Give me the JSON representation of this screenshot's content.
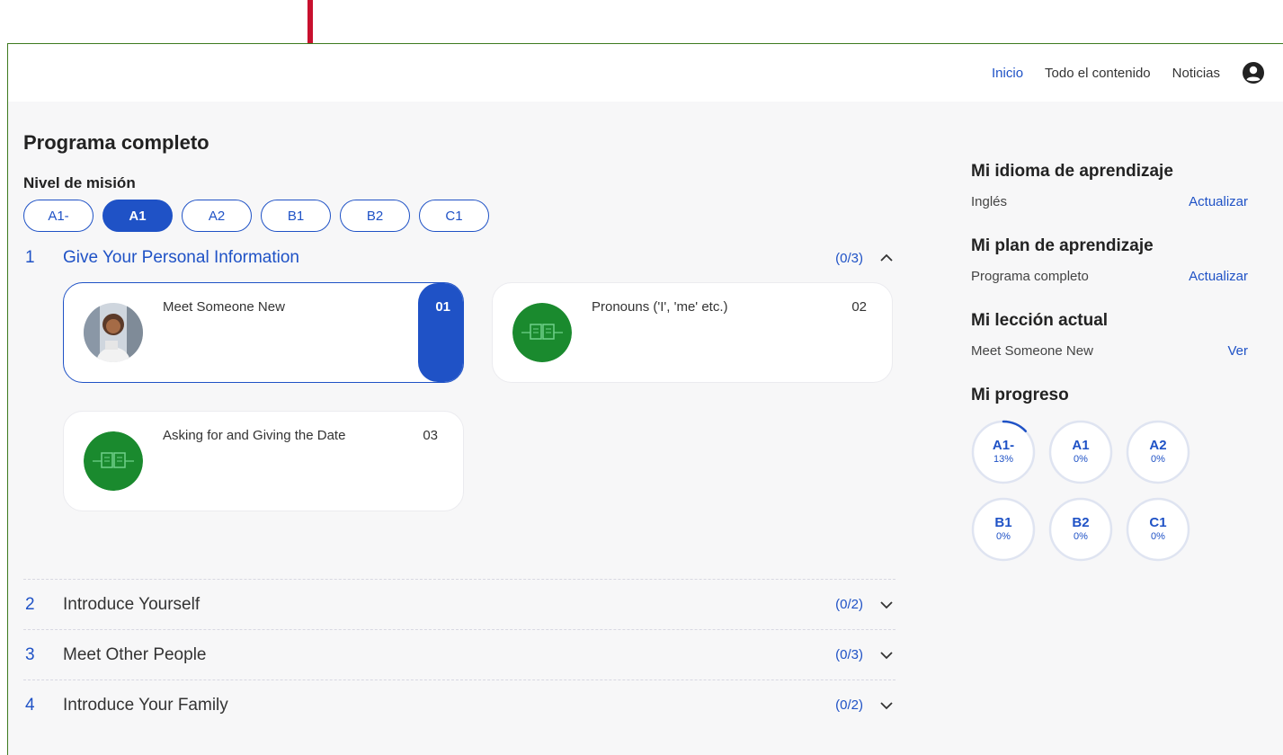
{
  "nav": {
    "links": [
      "Inicio",
      "Todo el contenido",
      "Noticias"
    ],
    "active": "Inicio",
    "profile_icon": "user-circle-icon"
  },
  "main": {
    "title": "Programa completo",
    "level_label": "Nivel de misión",
    "levels": [
      "A1-",
      "A1",
      "A2",
      "B1",
      "B2",
      "C1"
    ],
    "active_level": "A1",
    "units": [
      {
        "num": "1",
        "title": "Give Your Personal Information",
        "count": "(0/3)",
        "expanded": true,
        "lessons": [
          {
            "title": "Meet Someone New",
            "num": "01",
            "selected": true
          },
          {
            "title": "Pronouns ('I', 'me' etc.)",
            "num": "02"
          },
          {
            "title": "Asking for and Giving the Date",
            "num": "03"
          }
        ]
      },
      {
        "num": "2",
        "title": "Introduce Yourself",
        "count": "(0/2)"
      },
      {
        "num": "3",
        "title": "Meet Other People",
        "count": "(0/3)"
      },
      {
        "num": "4",
        "title": "Introduce Your Family",
        "count": "(0/2)"
      }
    ]
  },
  "side": {
    "language": {
      "heading": "Mi idioma de aprendizaje",
      "value": "Inglés",
      "action": "Actualizar"
    },
    "plan": {
      "heading": "Mi plan de aprendizaje",
      "value": "Programa completo",
      "action": "Actualizar"
    },
    "lesson": {
      "heading": "Mi lección actual",
      "value": "Meet Someone New",
      "action": "Ver"
    },
    "progress": {
      "heading": "Mi progreso",
      "items": [
        {
          "level": "A1-",
          "pct": "13%",
          "fraction": 0.13
        },
        {
          "level": "A1",
          "pct": "0%",
          "fraction": 0
        },
        {
          "level": "A2",
          "pct": "0%",
          "fraction": 0
        },
        {
          "level": "B1",
          "pct": "0%",
          "fraction": 0
        },
        {
          "level": "B2",
          "pct": "0%",
          "fraction": 0
        },
        {
          "level": "C1",
          "pct": "0%",
          "fraction": 0
        }
      ]
    }
  },
  "colors": {
    "accent": "#1f52c6",
    "frame_border": "#3d7a1f",
    "annotation": "#c8102e",
    "lesson_icon_bg": "#1a8a2e"
  }
}
